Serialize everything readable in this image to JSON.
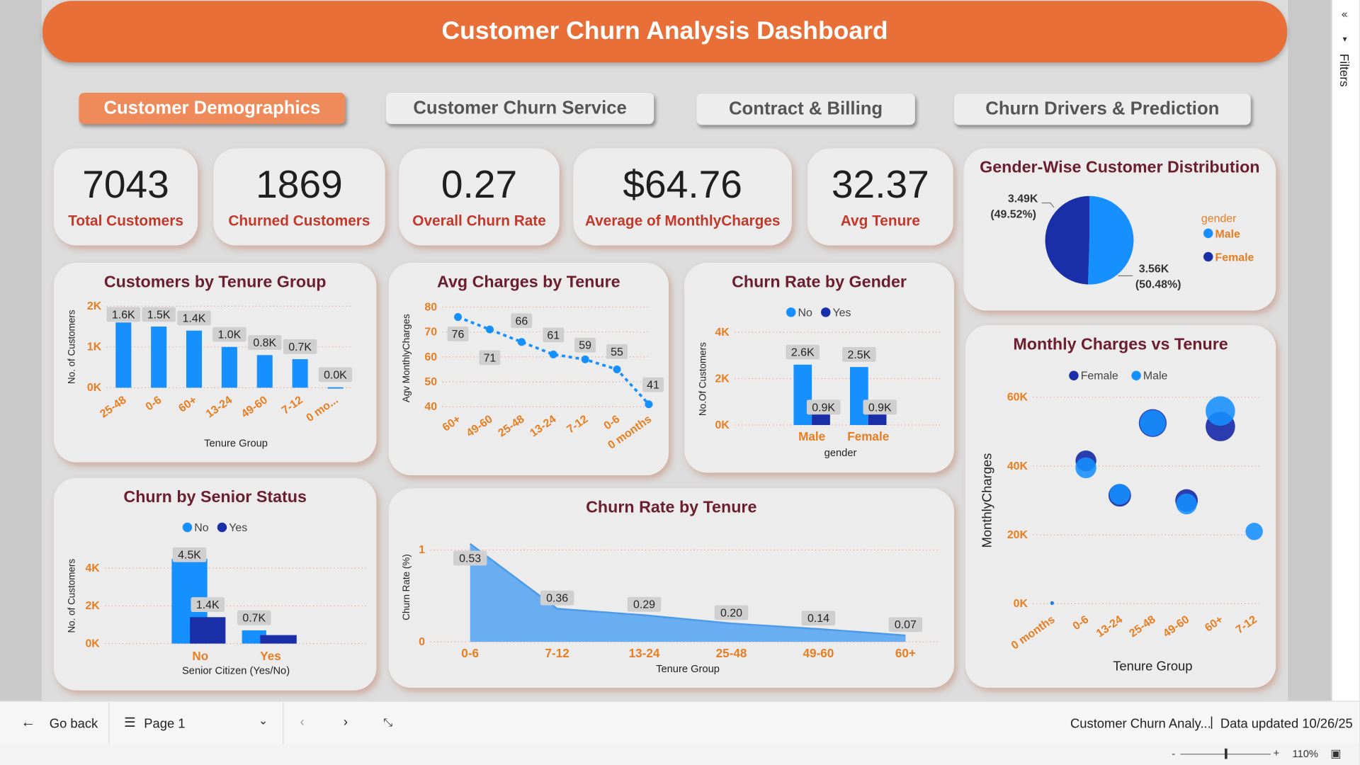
{
  "header": {
    "title": "Customer Churn Analysis Dashboard"
  },
  "nav": [
    {
      "label": "Customer Demographics",
      "active": true
    },
    {
      "label": "Customer Churn Service",
      "active": false
    },
    {
      "label": "Contract & Billing",
      "active": false
    },
    {
      "label": "Churn Drivers & Prediction",
      "active": false
    }
  ],
  "kpis": [
    {
      "value": "7043",
      "label": "Total Customers"
    },
    {
      "value": "1869",
      "label": "Churned Customers"
    },
    {
      "value": "0.27",
      "label": "Overall Churn Rate"
    },
    {
      "value": "$64.76",
      "label": "Average of MonthlyCharges"
    },
    {
      "value": "32.37",
      "label": "Avg Tenure"
    }
  ],
  "colors": {
    "header": "#e86f38",
    "active_tab": "#ef8a5b",
    "title_text": "#6b1e2e",
    "kpi_label": "#c0392b",
    "axis_label": "#e67e22",
    "light_blue": "#168fff",
    "dark_blue": "#1a2ea8",
    "area": "#5aa7f2"
  },
  "icons": {
    "collapse": "double-chevron-left-icon",
    "filter": "funnel-icon",
    "back": "arrow-left-icon",
    "page": "page-list-icon",
    "fit": "fit-to-page-icon"
  },
  "chart_data": [
    {
      "id": "tenure-group",
      "type": "bar",
      "title": "Customers by Tenure Group",
      "xlabel": "Tenure Group",
      "ylabel": "No. of Customers",
      "categories": [
        "25-48",
        "0-6",
        "60+",
        "13-24",
        "49-60",
        "7-12",
        "0 mo..."
      ],
      "values": [
        1600,
        1500,
        1400,
        1000,
        800,
        700,
        11
      ],
      "data_labels": [
        "1.6K",
        "1.5K",
        "1.4K",
        "1.0K",
        "0.8K",
        "0.7K",
        "0.0K"
      ],
      "yticks": [
        "0K",
        "1K",
        "2K"
      ],
      "ylim": [
        0,
        2000
      ],
      "grid": true
    },
    {
      "id": "avg-charges",
      "type": "line",
      "title": "Avg Charges by Tenure",
      "xlabel": "",
      "ylabel": "Agv MonthlyCharges",
      "categories": [
        "60+",
        "49-60",
        "25-48",
        "13-24",
        "7-12",
        "0-6",
        "0 months"
      ],
      "values": [
        76,
        71,
        66,
        61,
        59,
        55,
        41
      ],
      "yticks": [
        "40",
        "50",
        "60",
        "70",
        "80"
      ],
      "ylim": [
        40,
        80
      ],
      "grid": true
    },
    {
      "id": "gender-churn",
      "type": "bar",
      "title": "Churn Rate by Gender",
      "xlabel": "gender",
      "ylabel": "No.Of Customers",
      "categories": [
        "Male",
        "Female"
      ],
      "series": [
        {
          "name": "No",
          "values": [
            2600,
            2500
          ],
          "labels": [
            "2.6K",
            "2.5K"
          ]
        },
        {
          "name": "Yes",
          "values": [
            900,
            900
          ],
          "labels": [
            "0.9K",
            "0.9K"
          ]
        }
      ],
      "yticks": [
        "0K",
        "2K",
        "4K"
      ],
      "ylim": [
        0,
        4000
      ],
      "legend": "top",
      "grid": true
    },
    {
      "id": "gender-pie",
      "type": "pie",
      "title": "Gender-Wise Customer Distribution",
      "legend_title": "gender",
      "slices": [
        {
          "name": "Male",
          "value": 3.56,
          "label": "3.56K",
          "pct": "(50.48%)"
        },
        {
          "name": "Female",
          "value": 3.49,
          "label": "3.49K",
          "pct": "(49.52%)"
        }
      ],
      "legend": "right"
    },
    {
      "id": "senior-churn",
      "type": "bar",
      "title": "Churn by Senior Status",
      "xlabel": "Senior Citizen (Yes/No)",
      "ylabel": "No. of Customers",
      "categories": [
        "No",
        "Yes"
      ],
      "series": [
        {
          "name": "No",
          "values": [
            4500,
            700
          ],
          "labels": [
            "4.5K",
            "0.7K"
          ]
        },
        {
          "name": "Yes",
          "values": [
            1400,
            450
          ],
          "labels": [
            "1.4K",
            ""
          ]
        }
      ],
      "yticks": [
        "0K",
        "2K",
        "4K"
      ],
      "ylim": [
        0,
        5000
      ],
      "legend": "top",
      "grid": true
    },
    {
      "id": "churn-tenure",
      "type": "area",
      "title": "Churn Rate by Tenure",
      "xlabel": "Tenure Group",
      "ylabel": "Churn Rate (%)",
      "categories": [
        "0-6",
        "7-12",
        "13-24",
        "25-48",
        "49-60",
        "60+"
      ],
      "values": [
        0.53,
        0.36,
        0.29,
        0.2,
        0.14,
        0.07
      ],
      "data_labels": [
        "0.53",
        "0.36",
        "0.29",
        "0.20",
        "0.14",
        "0.07"
      ],
      "yticks": [
        "0",
        "1"
      ],
      "ylim": [
        0,
        1
      ],
      "grid": true
    },
    {
      "id": "charges-vs-tenure",
      "type": "scatter",
      "title": "Monthly Charges vs Tenure",
      "xlabel": "Tenure Group",
      "ylabel": "MonthlyCharges",
      "categories": [
        "0 months",
        "0-6",
        "13-24",
        "25-48",
        "49-60",
        "60+",
        "7-12"
      ],
      "series": [
        {
          "name": "Female",
          "points": [
            [
              0,
              200
            ],
            [
              1,
              41500
            ],
            [
              2,
              31500
            ],
            [
              3,
              52500
            ],
            [
              4,
              30000
            ],
            [
              5,
              51500
            ]
          ]
        },
        {
          "name": "Male",
          "points": [
            [
              0,
              100
            ],
            [
              1,
              39500
            ],
            [
              2,
              31800
            ],
            [
              3,
              52500
            ],
            [
              4,
              29000
            ],
            [
              5,
              56000
            ],
            [
              6,
              21000
            ]
          ]
        }
      ],
      "yticks": [
        "0K",
        "20K",
        "40K",
        "60K"
      ],
      "ylim": [
        0,
        65000
      ],
      "legend": "top",
      "grid": true
    }
  ],
  "sidebar": {
    "label": "Filters"
  },
  "bottom": {
    "back": "Go back",
    "page": "Page 1",
    "report_name": "Customer Churn Analy...",
    "separator": "|",
    "updated": "Data updated 10/26/25"
  },
  "status": {
    "minus": "-",
    "plus": "+",
    "zoom": "110%"
  }
}
